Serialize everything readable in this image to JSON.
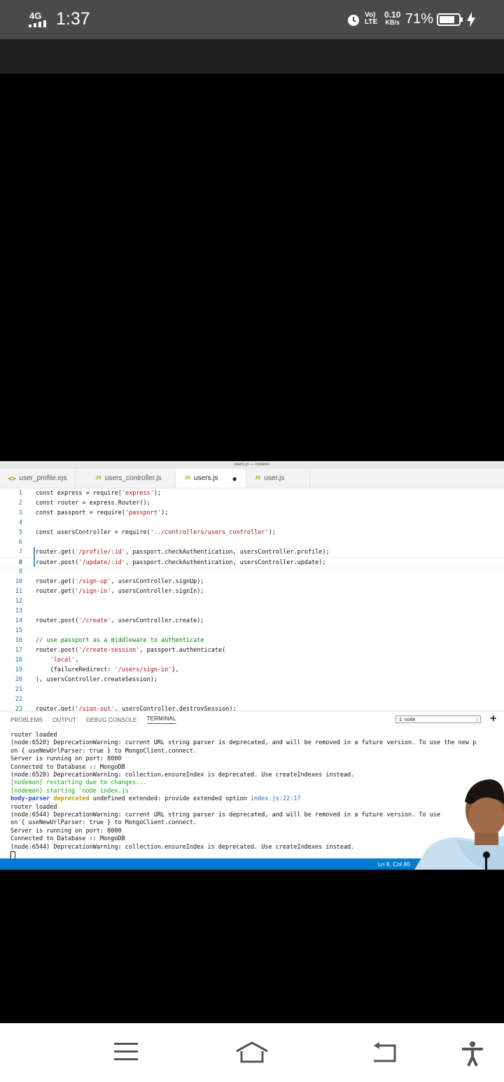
{
  "status_bar": {
    "network": "4G",
    "time": "1:37",
    "volte": [
      "Vo)",
      "LTE"
    ],
    "speed_value": "0.10",
    "speed_unit": "KB/s",
    "battery": "71%"
  },
  "vscode": {
    "window_title": "users.js — nodews",
    "tabs": [
      {
        "icon": "<>",
        "label": "user_profile.ejs"
      },
      {
        "icon": "JS",
        "label": "users_controller.js"
      },
      {
        "icon": "JS",
        "label": "users.js",
        "modified": "●"
      },
      {
        "icon": "JS",
        "label": "user.js"
      }
    ],
    "code_lines": [
      {
        "n": "1",
        "text": "const express = require('express');"
      },
      {
        "n": "2",
        "text": "const router = express.Router();"
      },
      {
        "n": "3",
        "text": "const passport = require('passport');"
      },
      {
        "n": "4",
        "text": ""
      },
      {
        "n": "5",
        "text": "const usersController = require('../controllers/users_controller');"
      },
      {
        "n": "6",
        "text": ""
      },
      {
        "n": "7",
        "text": "router.get('/profile/:id', passport.checkAuthentication, usersController.profile);"
      },
      {
        "n": "8",
        "text": "router.post('/update/:id', passport.checkAuthentication, usersController.update);"
      },
      {
        "n": "9",
        "text": ""
      },
      {
        "n": "10",
        "text": "router.get('/sign-up', usersController.signUp);"
      },
      {
        "n": "11",
        "text": "router.get('/sign-in', usersController.signIn);"
      },
      {
        "n": "12",
        "text": ""
      },
      {
        "n": "13",
        "text": ""
      },
      {
        "n": "14",
        "text": "router.post('/create', usersController.create);"
      },
      {
        "n": "15",
        "text": ""
      },
      {
        "n": "16",
        "text": "// use passport as a middleware to authenticate"
      },
      {
        "n": "17",
        "text": "router.post('/create-session', passport.authenticate("
      },
      {
        "n": "18",
        "text": "    'local',"
      },
      {
        "n": "19",
        "text": "    {failureRedirect: '/users/sign-in'},"
      },
      {
        "n": "20",
        "text": "), usersController.createSession);"
      },
      {
        "n": "21",
        "text": ""
      },
      {
        "n": "22",
        "text": ""
      },
      {
        "n": "23",
        "text": "router.get('/sign-out', usersController.destroySession);"
      }
    ],
    "panel_tabs": [
      "PROBLEMS",
      "OUTPUT",
      "DEBUG CONSOLE",
      "TERMINAL"
    ],
    "terminal_select": "1: node",
    "terminal_add": "+",
    "terminal_lines": [
      {
        "text": "router loaded"
      },
      {
        "text": "(node:6520) DeprecationWarning: current URL string parser is deprecated, and will be removed in a future version. To use the new p"
      },
      {
        "text": "on { useNewUrlParser: true } to MongoClient.connect."
      },
      {
        "text": "Server is running on port: 8000"
      },
      {
        "text": "Connected to Database :: MongoDB"
      },
      {
        "text": "(node:6520) DeprecationWarning: collection.ensureIndex is deprecated. Use createIndexes instead."
      },
      {
        "text": "[nodemon] restarting due to changes...",
        "style": "green"
      },
      {
        "text": "[nodemon] starting `node index.js`",
        "style": "green"
      },
      {
        "text": "router loaded"
      },
      {
        "text": "(node:6544) DeprecationWarning: current URL string parser is deprecated, and will be removed in a future version. To use"
      },
      {
        "text": "on { useNewUrlParser: true } to MongoClient.connect."
      },
      {
        "text": "Server is running on port: 8000"
      },
      {
        "text": "Connected to Database :: MongoDB"
      },
      {
        "text": "(node:6544) DeprecationWarning: collection.ensureIndex is deprecated. Use createIndexes instead."
      }
    ],
    "bodyparser_line": {
      "pkg": "body-parser",
      "flag": "deprecated",
      "msg": " undefined extended: provide extended option ",
      "loc": "index.js:22:17"
    },
    "status_position": "Ln 8, Col 80"
  },
  "nav_bar": {
    "icons": [
      "menu-icon",
      "home-icon",
      "back-icon",
      "accessibility-icon"
    ]
  },
  "colors": {
    "status_bar_bg": "#4a4a4a",
    "vscode_status_bg": "#007acc",
    "terminal_green": "#11a80d"
  }
}
